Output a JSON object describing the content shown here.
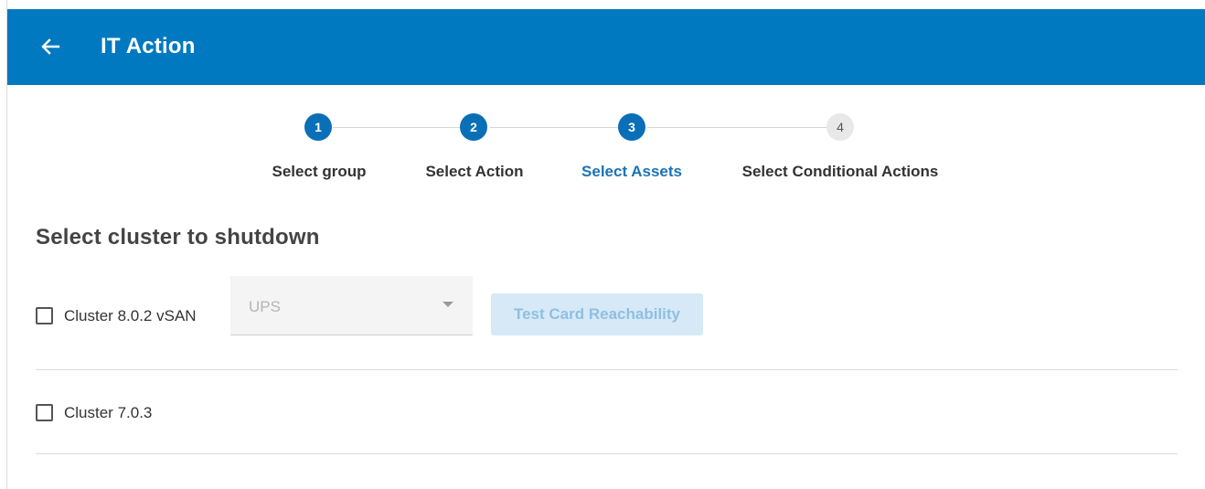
{
  "header": {
    "back_icon": "arrow-left-icon",
    "title": "IT Action",
    "color": "#0079c1"
  },
  "stepper": {
    "steps": [
      {
        "number": "1",
        "label": "Select group",
        "state": "done"
      },
      {
        "number": "2",
        "label": "Select Action",
        "state": "done"
      },
      {
        "number": "3",
        "label": "Select Assets",
        "state": "active"
      },
      {
        "number": "4",
        "label": "Select Conditional Actions",
        "state": "pending"
      }
    ]
  },
  "main": {
    "section_title": "Select cluster to shutdown",
    "clusters": [
      {
        "label": "Cluster 8.0.2 vSAN",
        "checked": false,
        "select": {
          "value": "UPS",
          "disabled": true
        },
        "button_label": "Test Card Reachability"
      },
      {
        "label": "Cluster 7.0.3",
        "checked": false
      }
    ]
  }
}
